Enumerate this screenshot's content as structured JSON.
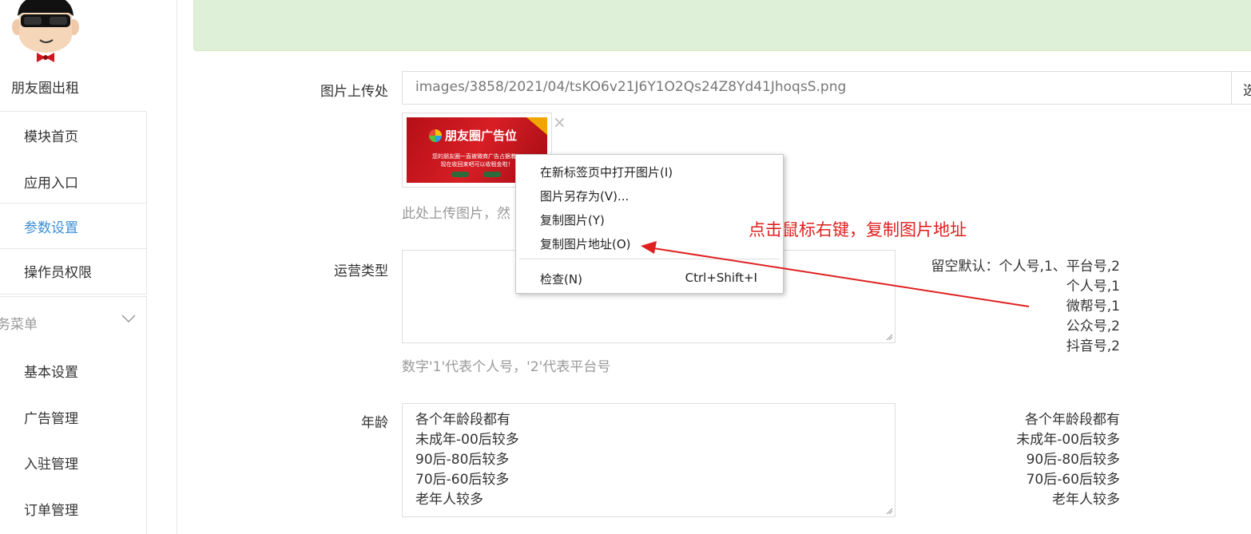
{
  "sidebar": {
    "site_name": "朋友圈出租",
    "items": [
      {
        "label": "模块首页"
      },
      {
        "label": "应用入口"
      },
      {
        "label": "参数设置"
      },
      {
        "label": "操作员权限"
      }
    ],
    "group_title": "务菜单",
    "group_items": [
      {
        "label": "基本设置"
      },
      {
        "label": "广告管理"
      },
      {
        "label": "入驻管理"
      },
      {
        "label": "订单管理"
      }
    ]
  },
  "form": {
    "image_label": "图片上传处",
    "image_url": "images/3858/2021/04/tsKO6v21J6Y1O2Qs24Z8Yd41JhoqsS.png",
    "select_button": "选",
    "thumbnail": {
      "title": "朋友圈广告位",
      "line1": "您的朋友圈一直被微商广告占据着！",
      "line2": "现在收回来吧可以收租金啦！"
    },
    "remove_icon": "×",
    "image_hint": "此处上传图片，然",
    "ops_label": "运营类型",
    "ops_value": "",
    "ops_hint": "数字'1'代表个人号，'2'代表平台号",
    "ops_notes": [
      "留空默认：个人号,1、平台号,2",
      "个人号,1",
      "微帮号,1",
      "公众号,2",
      "抖音号,2"
    ],
    "age_label": "年龄",
    "age_lines": [
      "各个年龄段都有",
      "未成年-00后较多",
      "90后-80后较多",
      "70后-60后较多",
      "老年人较多"
    ],
    "age_notes": [
      "各个年龄段都有",
      "未成年-00后较多",
      "90后-80后较多",
      "70后-60后较多",
      "老年人较多"
    ]
  },
  "context_menu": {
    "items": [
      {
        "label": "在新标签页中打开图片(I)"
      },
      {
        "label": "图片另存为(V)..."
      },
      {
        "label": "复制图片(Y)"
      },
      {
        "label": "复制图片地址(O)"
      }
    ],
    "inspect": {
      "label": "检查(N)",
      "shortcut": "Ctrl+Shift+I"
    }
  },
  "annotation": "点击鼠标右键，复制图片地址",
  "colors": {
    "accent": "#3d8fd6",
    "alert_bg": "#dff0d8",
    "annotation": "#e02020"
  }
}
